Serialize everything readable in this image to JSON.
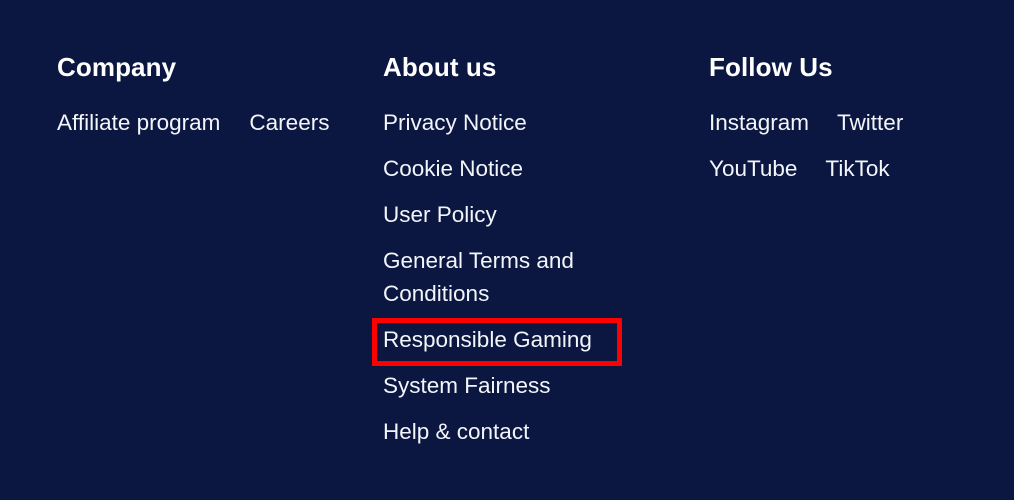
{
  "theme": {
    "background_color": "#0b1740",
    "text_color": "#f2f5fa",
    "heading_color": "#ffffff",
    "highlight_color": "#ff0000"
  },
  "footer": {
    "columns": [
      {
        "id": "company",
        "heading": "Company",
        "links": [
          {
            "label": "Affiliate program"
          },
          {
            "label": "Careers"
          }
        ]
      },
      {
        "id": "about-us",
        "heading": "About us",
        "links": [
          {
            "label": "Privacy Notice"
          },
          {
            "label": "Cookie Notice"
          },
          {
            "label": "User Policy"
          },
          {
            "label": "General Terms and Conditions"
          },
          {
            "label": "Responsible Gaming"
          },
          {
            "label": "System Fairness"
          },
          {
            "label": "Help & contact"
          }
        ]
      },
      {
        "id": "follow-us",
        "heading": "Follow Us",
        "links": [
          {
            "label": "Instagram"
          },
          {
            "label": "Twitter"
          },
          {
            "label": "YouTube"
          },
          {
            "label": "TikTok"
          }
        ]
      }
    ]
  },
  "annotation": {
    "target_label": "Responsible Gaming"
  }
}
